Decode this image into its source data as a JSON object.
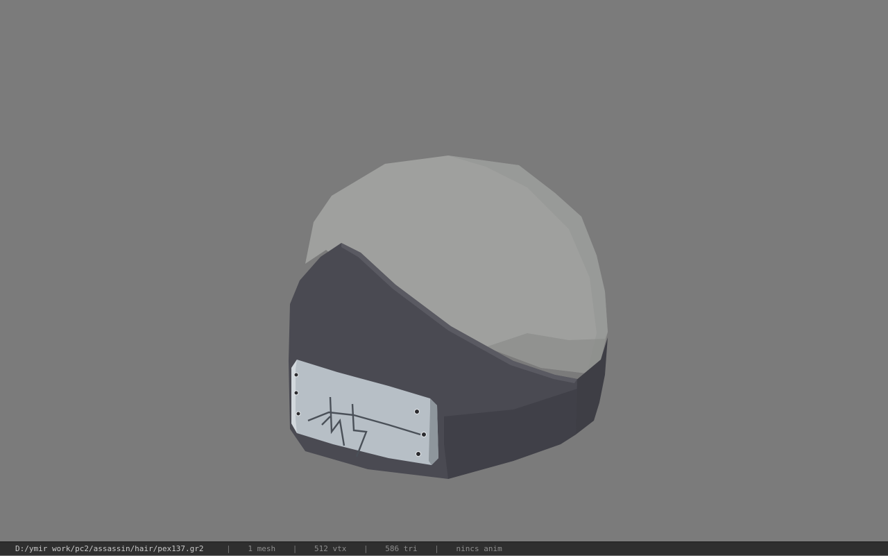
{
  "viewer": {
    "background_color": "#7b7b7b",
    "model": {
      "name": "helmet-model",
      "colors": {
        "dome": "#9fa09e",
        "dome_shadow": "#8b8c8a",
        "band": "#4a4a52",
        "band_dark": "#3c3c43",
        "plate": "#b7bfc6",
        "plate_edge": "#8e969c",
        "rivet": "#2b2b2f",
        "symbol": "#3a4048"
      }
    }
  },
  "statusbar": {
    "file_path": "D:/ymir work/pc2/assassin/hair/pex137.gr2",
    "separator": "|",
    "mesh_count": "1 mesh",
    "vertex_count": "512 vtx",
    "triangle_count": "586 tri",
    "anim_status": "nincs anim"
  }
}
